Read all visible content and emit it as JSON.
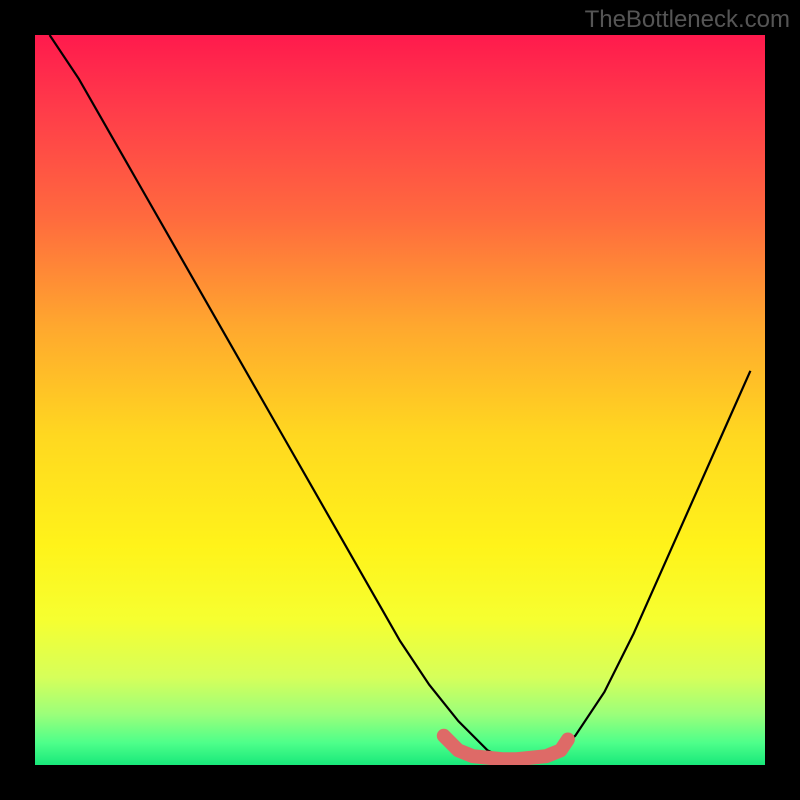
{
  "watermark": "TheBottleneck.com",
  "chart_data": {
    "type": "line",
    "title": "",
    "xlabel": "",
    "ylabel": "",
    "xlim": [
      0,
      100
    ],
    "ylim": [
      0,
      100
    ],
    "series": [
      {
        "name": "curve",
        "color": "#000000",
        "x": [
          2,
          6,
          10,
          14,
          18,
          22,
          26,
          30,
          34,
          38,
          42,
          46,
          50,
          54,
          58,
          62,
          64,
          66,
          70,
          74,
          78,
          82,
          86,
          90,
          94,
          98
        ],
        "values": [
          100,
          94,
          87,
          80,
          73,
          66,
          59,
          52,
          45,
          38,
          31,
          24,
          17,
          11,
          6,
          2,
          1,
          1,
          1,
          4,
          10,
          18,
          27,
          36,
          45,
          54
        ]
      },
      {
        "name": "highlight",
        "color": "#de6a67",
        "x": [
          56,
          58,
          60,
          62,
          64,
          66,
          68,
          70,
          72,
          73
        ],
        "values": [
          4,
          2,
          1.2,
          1,
          0.8,
          0.8,
          1,
          1.2,
          2,
          3.5
        ]
      }
    ],
    "gradient_stops": [
      {
        "pos": 0,
        "color": "#ff1a4d"
      },
      {
        "pos": 25,
        "color": "#ff6a3e"
      },
      {
        "pos": 55,
        "color": "#ffd820"
      },
      {
        "pos": 80,
        "color": "#f6ff30"
      },
      {
        "pos": 100,
        "color": "#18e87a"
      }
    ]
  }
}
